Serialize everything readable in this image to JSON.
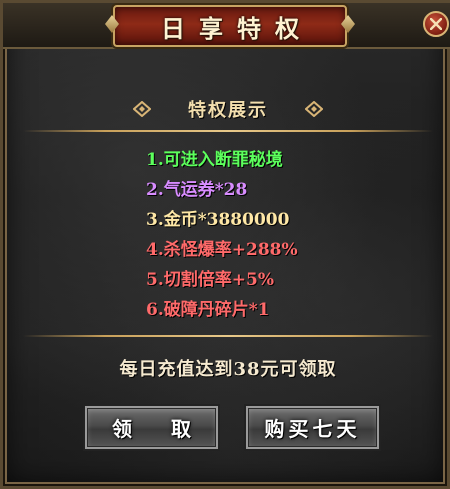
{
  "window": {
    "title": "日享特权"
  },
  "section": {
    "title": "特权展示"
  },
  "perks": [
    {
      "text": "1.可进入断罪秘境",
      "color": "#5cff5c"
    },
    {
      "text": "2.气运券*28",
      "color": "#d88cff"
    },
    {
      "text": "3.金币*3880000",
      "color": "#ffe8a6"
    },
    {
      "text": "4.杀怪爆率+288%",
      "color": "#ff6a6a"
    },
    {
      "text": "5.切割倍率+5%",
      "color": "#ff6a6a"
    },
    {
      "text": "6.破障丹碎片*1",
      "color": "#ff6a6a"
    }
  ],
  "footer": {
    "daily_text": "每日充值达到38元可领取",
    "claim_label": "领 取",
    "buy_label": "购买七天"
  },
  "icons": {
    "close": "close-icon",
    "ornament": "diamond-ornament-icon"
  },
  "colors": {
    "title_plate": "#8e2a17",
    "gold_border": "#c8a463",
    "section_title": "#f3dfae"
  }
}
